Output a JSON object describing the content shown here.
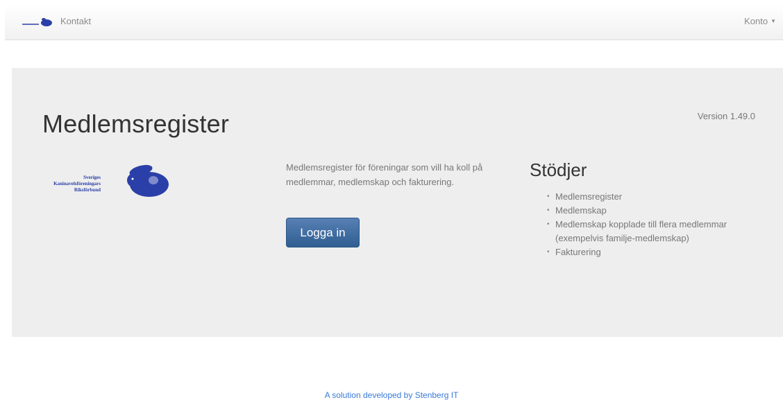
{
  "navbar": {
    "contact_label": "Kontakt",
    "account_label": "Konto"
  },
  "hero": {
    "title": "Medlemsregister",
    "version": "Version 1.49.0",
    "logo_text": [
      "Sveriges",
      "Kaninavelsföreningars",
      "Riksförbund"
    ],
    "description": "Medlemsregister för föreningar som vill ha koll på medlemmar, medlemskap och fakturering.",
    "login_label": "Logga in"
  },
  "supports": {
    "title": "Stödjer",
    "items": [
      "Medlemsregister",
      "Medlemskap",
      "Medlemskap kopplade till flera medlemmar (exempelvis familje-medlemskap)",
      "Fakturering"
    ]
  },
  "footer": {
    "text": "A solution developed by Stenberg IT"
  },
  "colors": {
    "primary_button": "#3c6aa3",
    "jumbotron_bg": "#eeeeee",
    "footer_link": "#3a7ad9",
    "logo_blue": "#2b3fa8"
  }
}
